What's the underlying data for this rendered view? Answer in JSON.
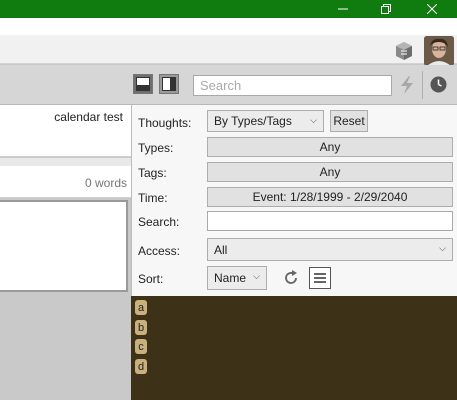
{
  "window": {
    "titlebar_color": "#107c10",
    "controls": {
      "minimize": "minimize-icon",
      "restore": "restore-icon",
      "close": "close-icon"
    }
  },
  "header": {
    "plugin_icon": "cube-icon",
    "avatar": "user-avatar"
  },
  "toolbar": {
    "layout_toggle_1": "single-pane-icon",
    "layout_toggle_2": "split-pane-icon",
    "search_placeholder": "Search",
    "bolt": "lightning-icon",
    "history": "clock-icon"
  },
  "thought": {
    "title": "calendar test",
    "word_count": "0 words"
  },
  "filters": {
    "thoughts_label": "Thoughts:",
    "thoughts_value": "By Types/Tags",
    "reset_label": "Reset",
    "types_label": "Types:",
    "types_value": "Any",
    "tags_label": "Tags:",
    "tags_value": "Any",
    "time_label": "Time:",
    "time_value": "Event: 1/28/1999 - 2/29/2040",
    "search_label": "Search:",
    "search_value": "",
    "access_label": "Access:",
    "access_value": "All",
    "sort_label": "Sort:",
    "sort_value": "Name",
    "refresh_icon": "refresh-icon",
    "list_icon": "list-icon"
  },
  "tag_list": [
    {
      "label": "a"
    },
    {
      "label": "b"
    },
    {
      "label": "c"
    },
    {
      "label": "d"
    }
  ],
  "colors": {
    "accent": "#107c10",
    "tag_panel_bg": "#3d3117",
    "tag_chip": "#c9b07d"
  }
}
